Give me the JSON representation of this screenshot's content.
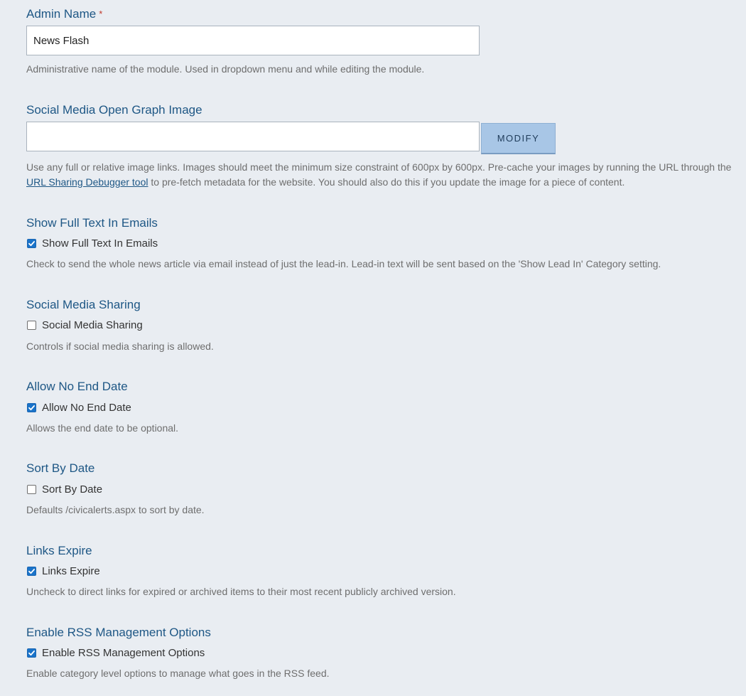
{
  "admin_name": {
    "label": "Admin Name",
    "required_mark": "*",
    "value": "News Flash",
    "help": "Administrative name of the module. Used in dropdown menu and while editing the module."
  },
  "og_image": {
    "label": "Social Media Open Graph Image",
    "value": "",
    "button_label": "MODIFY",
    "help_before": "Use any full or relative image links. Images should meet the minimum size constraint of 600px by 600px. Pre-cache your images by running the URL through the ",
    "help_link": "URL Sharing Debugger tool",
    "help_after": " to pre-fetch metadata for the website. You should also do this if you update the image for a piece of content."
  },
  "settings": [
    {
      "title": "Show Full Text In Emails",
      "checkbox_label": "Show Full Text In Emails",
      "checked": true,
      "help": "Check to send the whole news article via email instead of just the lead-in. Lead-in text will be sent based on the 'Show Lead In' Category setting."
    },
    {
      "title": "Social Media Sharing",
      "checkbox_label": "Social Media Sharing",
      "checked": false,
      "help": "Controls if social media sharing is allowed."
    },
    {
      "title": "Allow No End Date",
      "checkbox_label": "Allow No End Date",
      "checked": true,
      "help": "Allows the end date to be optional."
    },
    {
      "title": "Sort By Date",
      "checkbox_label": "Sort By Date",
      "checked": false,
      "help": "Defaults /civicalerts.aspx to sort by date."
    },
    {
      "title": "Links Expire",
      "checkbox_label": "Links Expire",
      "checked": true,
      "help": "Uncheck to direct links for expired or archived items to their most recent publicly archived version."
    },
    {
      "title": "Enable RSS Management Options",
      "checkbox_label": "Enable RSS Management Options",
      "checked": true,
      "help": "Enable category level options to manage what goes in the RSS feed."
    }
  ],
  "colors": {
    "background": "#e9edf2",
    "label": "#1e5785",
    "help_text": "#6e6e6e",
    "button": "#a8c6e6",
    "checkbox_checked": "#1a73c9"
  }
}
